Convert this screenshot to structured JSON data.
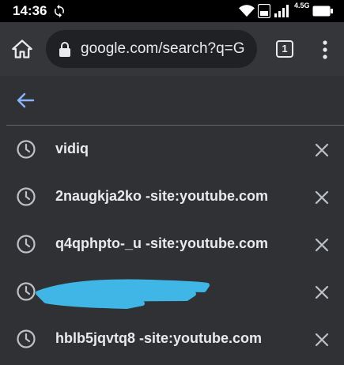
{
  "status_bar": {
    "time": "14:36",
    "network_label": "4.5G"
  },
  "toolbar": {
    "url": "google.com/search?q=G",
    "tab_count": "1"
  },
  "history": {
    "items": [
      {
        "text": "vidiq",
        "redacted": false
      },
      {
        "text": "2naugkja2ko -site:youtube.com",
        "redacted": false
      },
      {
        "text": "q4qphpto-_u -site:youtube.com",
        "redacted": false
      },
      {
        "text": "",
        "redacted": true
      },
      {
        "text": "hblb5jqvtq8 -site:youtube.com",
        "redacted": false
      }
    ]
  },
  "icons": {
    "home": "home-icon",
    "lock": "lock-icon",
    "tabs": "tab-switcher-icon",
    "menu": "more-vert-icon",
    "back": "arrow-back-icon",
    "history": "clock-icon",
    "delete": "close-icon"
  },
  "colors": {
    "accent": "#8ab4f8",
    "redaction": "#3fb6e6"
  }
}
